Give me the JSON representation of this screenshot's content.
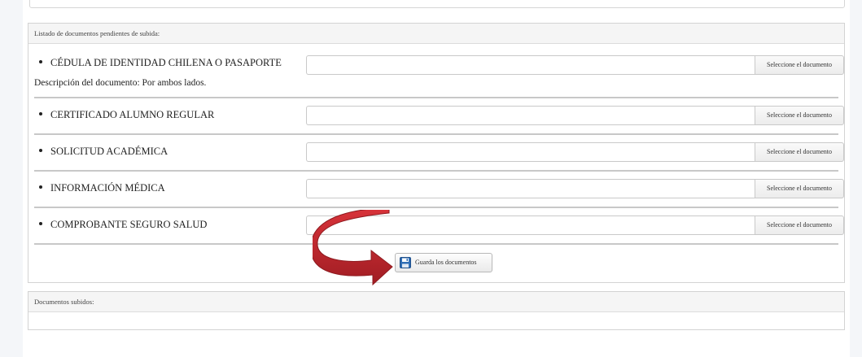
{
  "pending_panel": {
    "title": "Listado de documentos pendientes de subida:",
    "documents": [
      {
        "name": "CÉDULA DE IDENTIDAD CHILENA O PASAPORTE",
        "description": "Descripción del documento: Por ambos lados.",
        "button": "Seleccione el documento"
      },
      {
        "name": "CERTIFICADO ALUMNO REGULAR",
        "button": "Seleccione el documento"
      },
      {
        "name": "SOLICITUD ACADÉMICA",
        "button": "Seleccione el documento"
      },
      {
        "name": "INFORMACIÓN MÉDICA",
        "button": "Seleccione el documento"
      },
      {
        "name": "COMPROBANTE SEGURO SALUD",
        "button": "Seleccione el documento"
      }
    ],
    "save_button": "Guarda los documentos",
    "save_icon": "floppy-disk-icon"
  },
  "uploaded_panel": {
    "title": "Documentos subidos:"
  },
  "annotation": {
    "arrow_color": "#c0272d",
    "arrow_icon": "curved-arrow-icon"
  }
}
